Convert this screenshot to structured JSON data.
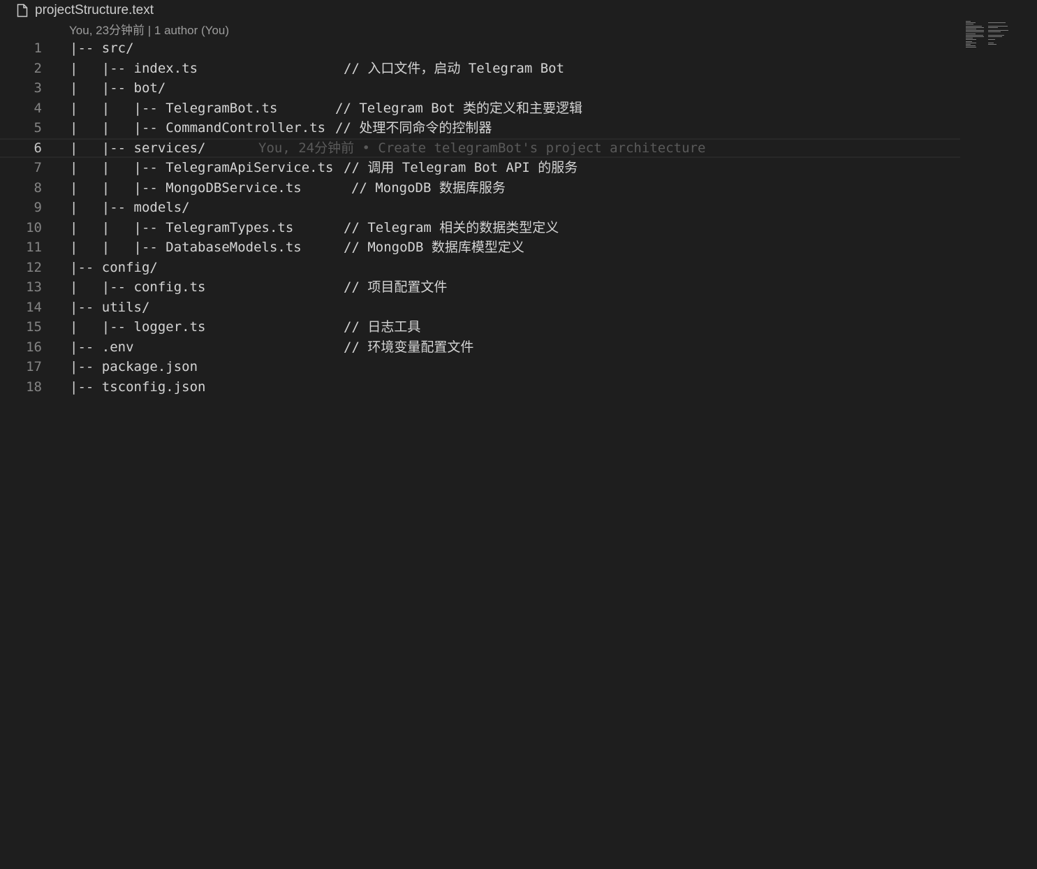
{
  "file": {
    "name": "projectStructure.text",
    "icon": "file-icon"
  },
  "blame_header": "You, 23分钟前 | 1 author (You)",
  "inline_blame": "You, 24分钟前 • Create telegramBot's project architecture",
  "current_line": 6,
  "lines": [
    {
      "n": "1",
      "code": "|-- src/",
      "comment": ""
    },
    {
      "n": "2",
      "code": "|   |-- index.ts",
      "comment": "// 入口文件，启动 Telegram Bot"
    },
    {
      "n": "3",
      "code": "|   |-- bot/",
      "comment": ""
    },
    {
      "n": "4",
      "code": "|   |   |-- TelegramBot.ts",
      "comment": "// Telegram Bot 类的定义和主要逻辑"
    },
    {
      "n": "5",
      "code": "|   |   |-- CommandController.ts",
      "comment": "// 处理不同命令的控制器"
    },
    {
      "n": "6",
      "code": "|   |-- services/",
      "comment": ""
    },
    {
      "n": "7",
      "code": "|   |   |-- TelegramApiService.ts",
      "comment": "// 调用 Telegram Bot API 的服务"
    },
    {
      "n": "8",
      "code": "|   |   |-- MongoDBService.ts",
      "comment": "// MongoDB 数据库服务"
    },
    {
      "n": "9",
      "code": "|   |-- models/",
      "comment": ""
    },
    {
      "n": "10",
      "code": "|   |   |-- TelegramTypes.ts",
      "comment": "// Telegram 相关的数据类型定义"
    },
    {
      "n": "11",
      "code": "|   |   |-- DatabaseModels.ts",
      "comment": "// MongoDB 数据库模型定义"
    },
    {
      "n": "12",
      "code": "|-- config/",
      "comment": ""
    },
    {
      "n": "13",
      "code": "|   |-- config.ts",
      "comment": "// 项目配置文件"
    },
    {
      "n": "14",
      "code": "|-- utils/",
      "comment": ""
    },
    {
      "n": "15",
      "code": "|   |-- logger.ts",
      "comment": "// 日志工具"
    },
    {
      "n": "16",
      "code": "|-- .env",
      "comment": "// 环境变量配置文件"
    },
    {
      "n": "17",
      "code": "|-- package.json",
      "comment": ""
    },
    {
      "n": "18",
      "code": "|-- tsconfig.json",
      "comment": ""
    }
  ]
}
